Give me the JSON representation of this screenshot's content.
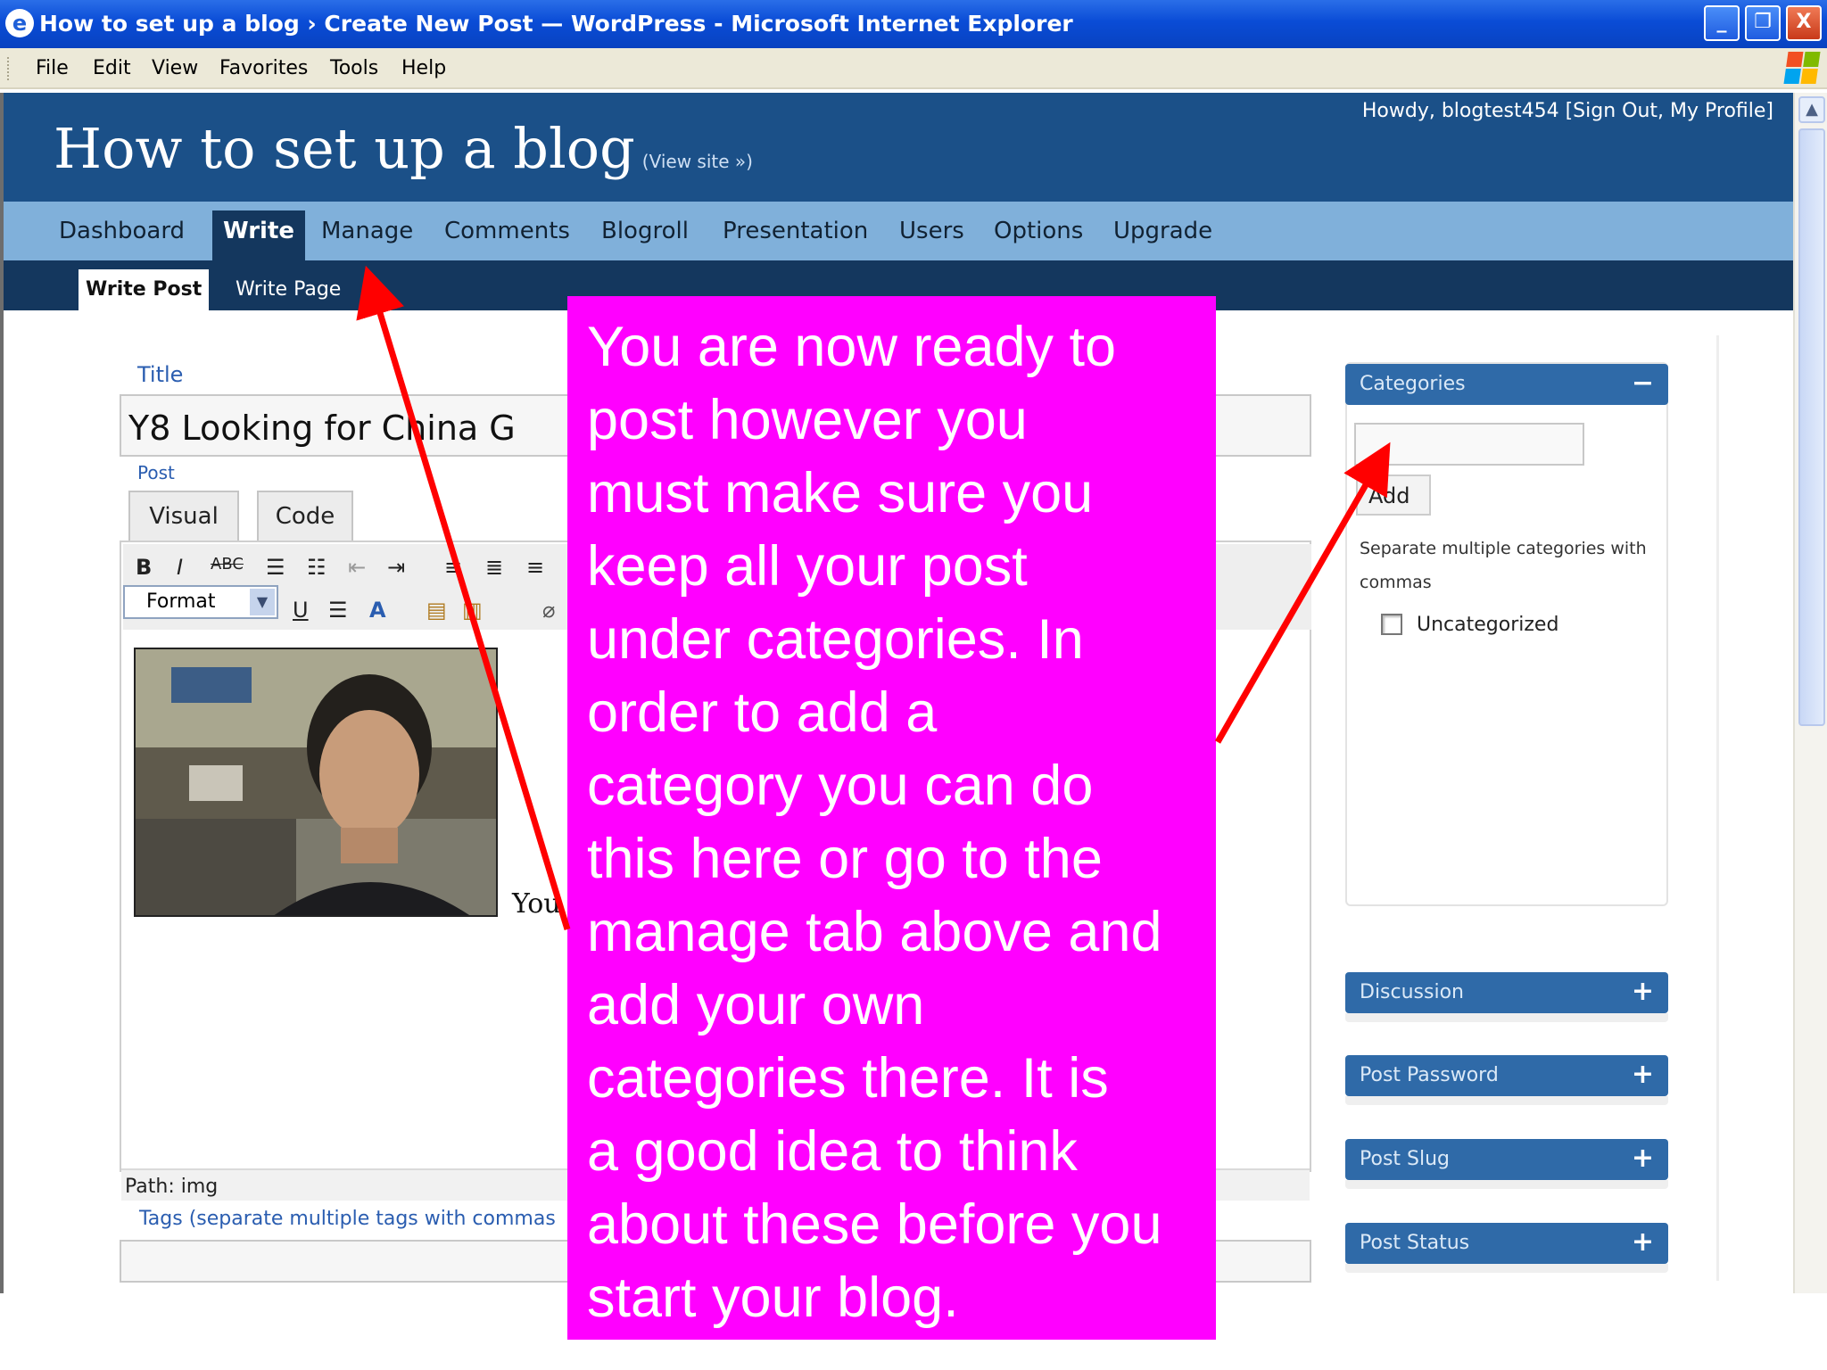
{
  "window": {
    "title": "How to set up a blog › Create New Post — WordPress - Microsoft Internet Explorer",
    "minimize_glyph": "_",
    "maximize_glyph": "❐",
    "close_glyph": "X"
  },
  "menubar": {
    "items": [
      "File",
      "Edit",
      "View",
      "Favorites",
      "Tools",
      "Help"
    ]
  },
  "wp": {
    "site_title": "How to set up a blog",
    "view_site": "(View site »)",
    "user_bar": "Howdy, blogtest454  [Sign Out, My Profile]",
    "menu": [
      "Dashboard",
      "Write",
      "Manage",
      "Comments",
      "Blogroll",
      "Presentation",
      "Users",
      "Options",
      "Upgrade"
    ],
    "submenu": [
      "Write Post",
      "Write Page"
    ]
  },
  "editor": {
    "title_label": "Title",
    "title_value": "Y8 Looking for China G",
    "post_label": "Post",
    "tabs": [
      "Visual",
      "Code"
    ],
    "font_select": "Format",
    "visible_text": "You",
    "path": "Path: img",
    "tags_label": "Tags (separate multiple tags with commas"
  },
  "sidebar": {
    "categories_title": "Categories",
    "categories_toggle": "−",
    "add_button": "Add",
    "hint": "Separate multiple categories with commas",
    "uncategorized": "Uncategorized",
    "panels": [
      {
        "title": "Discussion",
        "toggle": "+"
      },
      {
        "title": "Post Password",
        "toggle": "+"
      },
      {
        "title": "Post Slug",
        "toggle": "+"
      },
      {
        "title": "Post Status",
        "toggle": "+"
      }
    ]
  },
  "annotation": {
    "text": "You are now ready to\npost however you\nmust make sure you\nkeep all your post\nunder categories.  In\norder to add a\ncategory you can do\nthis here or go to the\nmanage tab above and\nadd your own\ncategories there.  It is\na good idea to think\nabout these before you\nstart your blog.",
    "background": "#ff00ff",
    "arrow_color": "#ff0000"
  },
  "colors": {
    "wp_header": "#1b5088",
    "wp_menu": "#80b0da",
    "wp_submenu": "#14375e",
    "panel_header": "#2f6aa8"
  }
}
